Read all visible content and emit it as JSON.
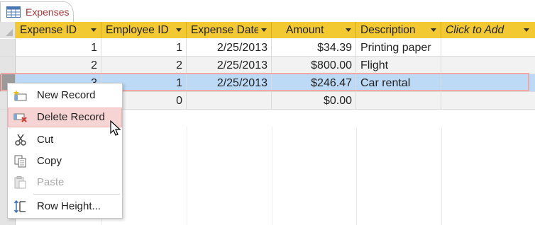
{
  "tab": {
    "label": "Expenses",
    "icon": "table-icon"
  },
  "columns": [
    {
      "label": "Expense ID",
      "has_dropdown": true
    },
    {
      "label": "Employee ID",
      "has_dropdown": true
    },
    {
      "label": "Expense Date",
      "has_dropdown": true
    },
    {
      "label": "Amount",
      "has_dropdown": true
    },
    {
      "label": "Description",
      "has_dropdown": true
    },
    {
      "label": "Click to Add",
      "has_dropdown": true
    }
  ],
  "rows": [
    {
      "expense_id": "1",
      "employee_id": "1",
      "date": "2/25/2013",
      "amount": "$34.39",
      "description": "Printing paper"
    },
    {
      "expense_id": "2",
      "employee_id": "2",
      "date": "2/25/2013",
      "amount": "$800.00",
      "description": "Flight"
    },
    {
      "expense_id": "3",
      "employee_id": "1",
      "date": "2/25/2013",
      "amount": "$246.47",
      "description": "Car rental"
    },
    {
      "expense_id": "",
      "employee_id": "0",
      "date": "",
      "amount": "$0.00",
      "description": ""
    }
  ],
  "selected_row_index": 2,
  "context_menu": {
    "items": [
      {
        "label": "New Record",
        "icon": "new-record-icon",
        "enabled": true,
        "highlighted": false
      },
      {
        "label": "Delete Record",
        "icon": "delete-record-icon",
        "enabled": true,
        "highlighted": true
      },
      {
        "label": "Cut",
        "icon": "scissors-icon",
        "enabled": true,
        "highlighted": false
      },
      {
        "label": "Copy",
        "icon": "copy-icon",
        "enabled": true,
        "highlighted": false
      },
      {
        "label": "Paste",
        "icon": "paste-icon",
        "enabled": false,
        "highlighted": false
      },
      {
        "label": "Row Height...",
        "icon": "row-height-icon",
        "enabled": true,
        "highlighted": false
      }
    ]
  },
  "colors": {
    "header_bg": "#f3c931",
    "tab_text": "#a4373a",
    "selected_row_bg": "#bcd9f5",
    "selected_row_outline": "#f2a7a7",
    "menu_highlight": "#f7d4d4"
  }
}
